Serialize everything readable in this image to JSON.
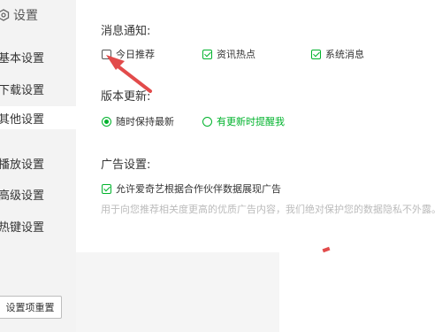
{
  "sidebar": {
    "title": "设置",
    "items": [
      {
        "label": "基本设置"
      },
      {
        "label": "下载设置"
      },
      {
        "label": "其他设置"
      },
      {
        "label": "播放设置"
      },
      {
        "label": "高级设置"
      },
      {
        "label": "热键设置"
      }
    ],
    "active_index": 2,
    "reset_label": "设置项重置"
  },
  "notifications": {
    "title": "消息通知:",
    "options": [
      {
        "label": "今日推荐",
        "checked": false
      },
      {
        "label": "资讯热点",
        "checked": true
      },
      {
        "label": "系统消息",
        "checked": true
      }
    ]
  },
  "update": {
    "title": "版本更新:",
    "options": [
      {
        "label": "随时保持最新",
        "selected": true
      },
      {
        "label": "有更新时提醒我",
        "selected": false
      }
    ]
  },
  "ads": {
    "title": "广告设置:",
    "checkbox_label": "允许爱奇艺根据合作伙伴数据展现广告",
    "checked": true,
    "hint": "用于向您推荐相关度更高的优质广告内容，我们绝对保护您的数据隐私不外露。"
  },
  "colors": {
    "accent": "#00b32c",
    "arrow": "#e24b4b"
  }
}
